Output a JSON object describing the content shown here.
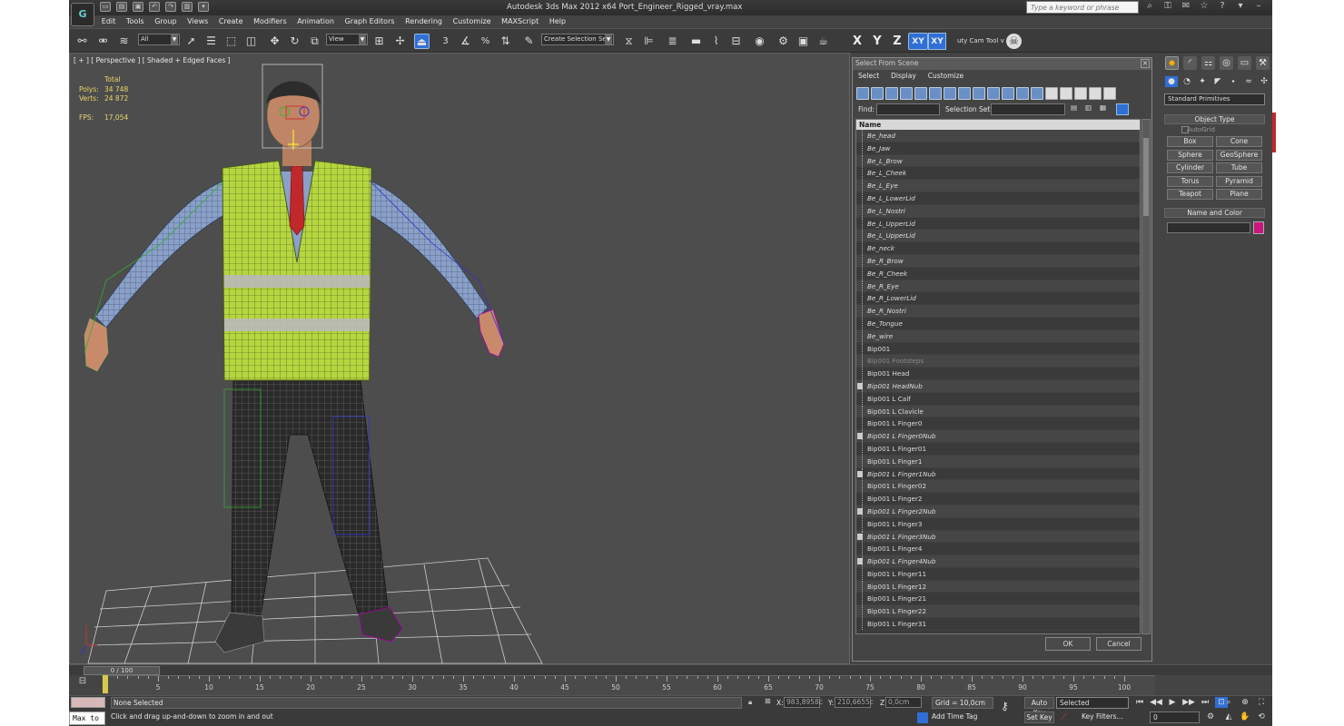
{
  "app": {
    "title": "Autodesk 3ds Max  2012 x64     Port_Engineer_Rigged_vray.max",
    "logo_text": "G",
    "search_placeholder": "Type a keyword or phrase"
  },
  "menus": [
    "Edit",
    "Tools",
    "Group",
    "Views",
    "Create",
    "Modifiers",
    "Animation",
    "Graph Editors",
    "Rendering",
    "Customize",
    "MAXScript",
    "Help"
  ],
  "toolbar": {
    "filter_value": "All",
    "ref_coord_value": "View",
    "snap_label": "3",
    "selection_set_value": "Create Selection Se",
    "axis_x": "X",
    "axis_y": "Y",
    "axis_z": "Z",
    "axis_xy": "XY",
    "axis_xy2": "XY",
    "cam_tool_label": "uty Cam Tool v"
  },
  "viewport": {
    "label": "[ + ] [ Perspective ] [ Shaded + Edged Faces ]",
    "stats_header": "Total",
    "polys_label": "Polys:",
    "polys_value": "34 748",
    "verts_label": "Verts:",
    "verts_value": "24 872",
    "fps_label": "FPS:",
    "fps_value": "17,054",
    "colors": {
      "vest": "#b6d63f",
      "shirt": "#8aa0c8",
      "pants": "#2a2a2a",
      "tie": "#c0282c",
      "grid": "#cfcfcf"
    }
  },
  "select_dialog": {
    "title": "Select From Scene",
    "menus": [
      "Select",
      "Display",
      "Customize"
    ],
    "find_label": "Find:",
    "selection_set_label": "Selection Set:",
    "column_name": "Name",
    "items": [
      {
        "name": "Be_head",
        "style": "italic"
      },
      {
        "name": "Be_Jaw",
        "style": "italic"
      },
      {
        "name": "Be_L_Brow",
        "style": "italic"
      },
      {
        "name": "Be_L_Cheek",
        "style": "italic"
      },
      {
        "name": "Be_L_Eye",
        "style": "italic"
      },
      {
        "name": "Be_L_LowerLid",
        "style": "italic"
      },
      {
        "name": "Be_L_Nostri",
        "style": "italic"
      },
      {
        "name": "Be_L_UpperLid",
        "style": "italic"
      },
      {
        "name": "Be_L_UpperLid",
        "style": "italic"
      },
      {
        "name": "Be_neck",
        "style": "italic"
      },
      {
        "name": "Be_R_Brow",
        "style": "italic"
      },
      {
        "name": "Be_R_Cheek",
        "style": "italic"
      },
      {
        "name": "Be_R_Eye",
        "style": "italic"
      },
      {
        "name": "Be_R_LowerLid",
        "style": "italic"
      },
      {
        "name": "Be_R_Nostri",
        "style": "italic"
      },
      {
        "name": "Be_Tongue",
        "style": "italic"
      },
      {
        "name": "Be_wire",
        "style": "italic"
      },
      {
        "name": "Bip001",
        "style": "normal"
      },
      {
        "name": "Bip001 Footsteps",
        "style": "dim"
      },
      {
        "name": "Bip001 Head",
        "style": "normal"
      },
      {
        "name": "Bip001 HeadNub",
        "style": "italic",
        "nub": true
      },
      {
        "name": "Bip001 L Calf",
        "style": "normal"
      },
      {
        "name": "Bip001 L Clavicle",
        "style": "normal"
      },
      {
        "name": "Bip001 L Finger0",
        "style": "normal"
      },
      {
        "name": "Bip001 L Finger0Nub",
        "style": "italic",
        "nub": true
      },
      {
        "name": "Bip001 L Finger01",
        "style": "normal"
      },
      {
        "name": "Bip001 L Finger1",
        "style": "normal"
      },
      {
        "name": "Bip001 L Finger1Nub",
        "style": "italic",
        "nub": true
      },
      {
        "name": "Bip001 L Finger02",
        "style": "normal"
      },
      {
        "name": "Bip001 L Finger2",
        "style": "normal"
      },
      {
        "name": "Bip001 L Finger2Nub",
        "style": "italic",
        "nub": true
      },
      {
        "name": "Bip001 L Finger3",
        "style": "normal"
      },
      {
        "name": "Bip001 L Finger3Nub",
        "style": "italic",
        "nub": true
      },
      {
        "name": "Bip001 L Finger4",
        "style": "normal"
      },
      {
        "name": "Bip001 L Finger4Nub",
        "style": "italic",
        "nub": true
      },
      {
        "name": "Bip001 L Finger11",
        "style": "normal"
      },
      {
        "name": "Bip001 L Finger12",
        "style": "normal"
      },
      {
        "name": "Bip001 L Finger21",
        "style": "normal"
      },
      {
        "name": "Bip001 L Finger22",
        "style": "normal"
      },
      {
        "name": "Bip001 L Finger31",
        "style": "normal"
      }
    ],
    "ok_label": "OK",
    "cancel_label": "Cancel"
  },
  "command_panel": {
    "category_value": "Standard Primitives",
    "object_type_header": "Object Type",
    "autogrid_label": "AutoGrid",
    "buttons": [
      "Box",
      "Cone",
      "Sphere",
      "GeoSphere",
      "Cylinder",
      "Tube",
      "Torus",
      "Pyramid",
      "Teapot",
      "Plane"
    ],
    "name_color_header": "Name and Color",
    "object_color": "#c9177d"
  },
  "timeline": {
    "frame_indicator": "0 / 100",
    "ticks": [
      5,
      10,
      15,
      20,
      25,
      30,
      35,
      40,
      45,
      50,
      55,
      60,
      65,
      70,
      75,
      80,
      85,
      90,
      95,
      100
    ]
  },
  "status": {
    "maxscript_label": "Max to",
    "selection_status": "None Selected",
    "prompt": "Click and drag up-and-down to zoom in and out",
    "x_label": "X:",
    "x_value": "983,8958c",
    "y_label": "Y:",
    "y_value": "210,6655c",
    "z_label": "Z:",
    "z_value": "0,0cm",
    "grid": "Grid = 10,0cm",
    "add_time_tag": "Add Time Tag",
    "auto_key": "Auto Key",
    "set_key": "Set Key",
    "selected": "Selected",
    "key_filters": "Key Filters...",
    "current_frame": "0"
  }
}
